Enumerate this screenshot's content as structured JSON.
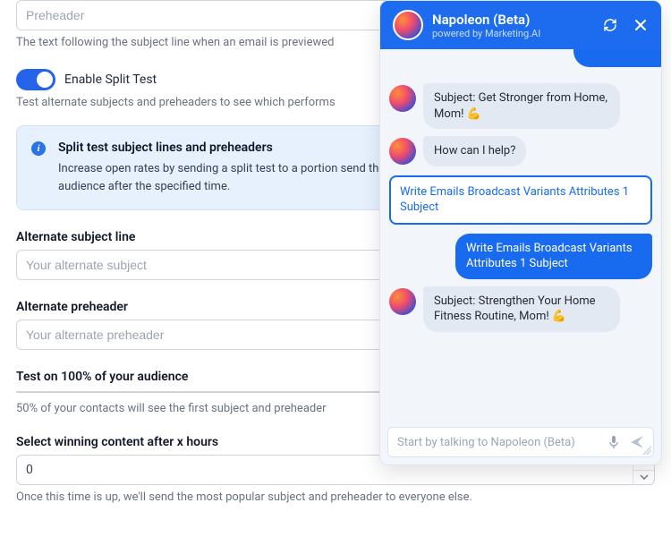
{
  "preheader": {
    "placeholder": "Preheader",
    "help": "The text following the subject line when an email is previewed"
  },
  "splitTest": {
    "toggleLabel": "Enable Split Test",
    "enabled": true,
    "sub": "Test alternate subjects and preheaders to see which performs"
  },
  "infoBox": {
    "title": "Split test subject lines and preheaders",
    "body": "Increase open rates by sending a split test to a portion send the subject line and preheader with the highest op audience after the specified time."
  },
  "altSubject": {
    "label": "Alternate subject line",
    "placeholder": "Your alternate subject"
  },
  "altPreheader": {
    "label": "Alternate preheader",
    "placeholder": "Your alternate preheader"
  },
  "testOn": {
    "label": "Test on 100% of your audience",
    "sub": "50% of your contacts will see the first subject and preheader"
  },
  "winning": {
    "label": "Select winning content after x hours",
    "value": "0",
    "help": "Once this time is up, we'll send the most popular subject and preheader to everyone else."
  },
  "chat": {
    "title": "Napoleon (Beta)",
    "sub": "powered by Marketing.AI",
    "messages": {
      "m1": "Subject: Get Stronger from Home, Mom! 💪",
      "m2": "How can I help?",
      "command": "Write Emails Broadcast Variants Attributes 1 Subject",
      "m3": "Write Emails Broadcast Variants Attributes 1 Subject",
      "m4": "Subject: Strengthen Your Home Fitness Routine, Mom! 💪"
    },
    "inputPlaceholder": "Start by talking to Napoleon (Beta)"
  }
}
